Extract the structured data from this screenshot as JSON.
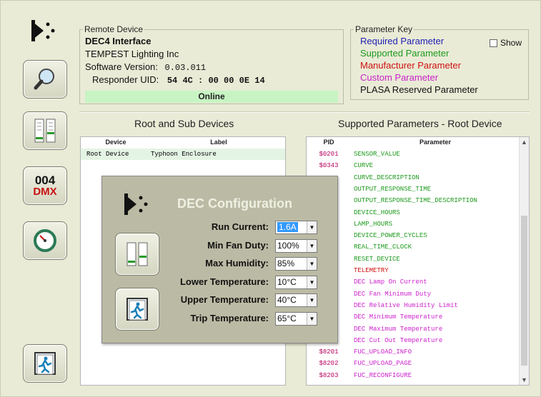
{
  "remote_device": {
    "legend": "Remote Device",
    "name": "DEC4 Interface",
    "manufacturer": "TEMPEST Lighting Inc",
    "software_label": "Software Version:",
    "software_value": "0.03.011",
    "uid_label": "Responder UID:",
    "uid_value": "54 4C : 00 00 0E 14",
    "status": "Online"
  },
  "parameter_key": {
    "legend": "Parameter Key",
    "show_label": "Show",
    "items": [
      {
        "label": "Required Parameter",
        "color": "#1f1fb4"
      },
      {
        "label": "Supported Parameter",
        "color": "#1d9a1d"
      },
      {
        "label": "Manufacturer Parameter",
        "color": "#d01010"
      },
      {
        "label": "Custom Parameter",
        "color": "#cc22cc"
      },
      {
        "label": "PLASA Reserved Parameter",
        "color": "#111111"
      }
    ]
  },
  "devices": {
    "title": "Root and Sub Devices",
    "col_device": "Device",
    "col_label": "Label",
    "rows": [
      {
        "device": "Root Device",
        "label": "Typhoon Enclosure"
      }
    ]
  },
  "parameters": {
    "title": "Supported Parameters - Root Device",
    "col_pid": "PID",
    "col_param": "Parameter",
    "rows": [
      {
        "pid": "$0201",
        "name": "SENSOR_VALUE",
        "color": "#1d9a1d"
      },
      {
        "pid": "$0343",
        "name": "CURVE",
        "color": "#1d9a1d"
      },
      {
        "pid": "",
        "name": "CURVE_DESCRIPTION",
        "color": "#1d9a1d"
      },
      {
        "pid": "",
        "name": "OUTPUT_RESPONSE_TIME",
        "color": "#1d9a1d"
      },
      {
        "pid": "",
        "name": "OUTPUT_RESPONSE_TIME_DESCRIPTION",
        "color": "#1d9a1d"
      },
      {
        "pid": "",
        "name": "DEVICE_HOURS",
        "color": "#1d9a1d"
      },
      {
        "pid": "",
        "name": "LAMP_HOURS",
        "color": "#1d9a1d"
      },
      {
        "pid": "",
        "name": "DEVICE_POWER_CYCLES",
        "color": "#1d9a1d"
      },
      {
        "pid": "",
        "name": "REAL_TIME_CLOCK",
        "color": "#1d9a1d"
      },
      {
        "pid": "",
        "name": "RESET_DEVICE",
        "color": "#1d9a1d"
      },
      {
        "pid": "",
        "name": "TELEMETRY",
        "color": "#d01010"
      },
      {
        "pid": "",
        "name": "DEC Lamp On Current",
        "color": "#cc22cc"
      },
      {
        "pid": "",
        "name": "DEC Fan Minimum Duty",
        "color": "#cc22cc"
      },
      {
        "pid": "",
        "name": "DEC Relative Humidity Limit",
        "color": "#cc22cc"
      },
      {
        "pid": "",
        "name": "DEC Minimum Temperature",
        "color": "#cc22cc"
      },
      {
        "pid": "",
        "name": "DEC Maximum Temperature",
        "color": "#cc22cc"
      },
      {
        "pid": "",
        "name": "DEC Cut Out Temperature",
        "color": "#cc22cc"
      },
      {
        "pid": "$8201",
        "name": "FUC_UPLOAD_INFO",
        "color": "#cc22cc"
      },
      {
        "pid": "$8202",
        "name": "FUC_UPLOAD_PAGE",
        "color": "#cc22cc"
      },
      {
        "pid": "$8203",
        "name": "FUC_RECONFIGURE",
        "color": "#cc22cc"
      }
    ]
  },
  "sidebar": {
    "dmx_number": "004",
    "dmx_text": "DMX"
  },
  "dialog": {
    "title": "DEC Configuration",
    "fields": [
      {
        "label": "Run Current:",
        "value": "1.6A"
      },
      {
        "label": "Min Fan Duty:",
        "value": "100%"
      },
      {
        "label": "Max Humidity:",
        "value": "85%"
      },
      {
        "label": "Lower Temperature:",
        "value": "10°C"
      },
      {
        "label": "Upper Temperature:",
        "value": "40°C"
      },
      {
        "label": "Trip Temperature:",
        "value": "65°C"
      }
    ]
  }
}
